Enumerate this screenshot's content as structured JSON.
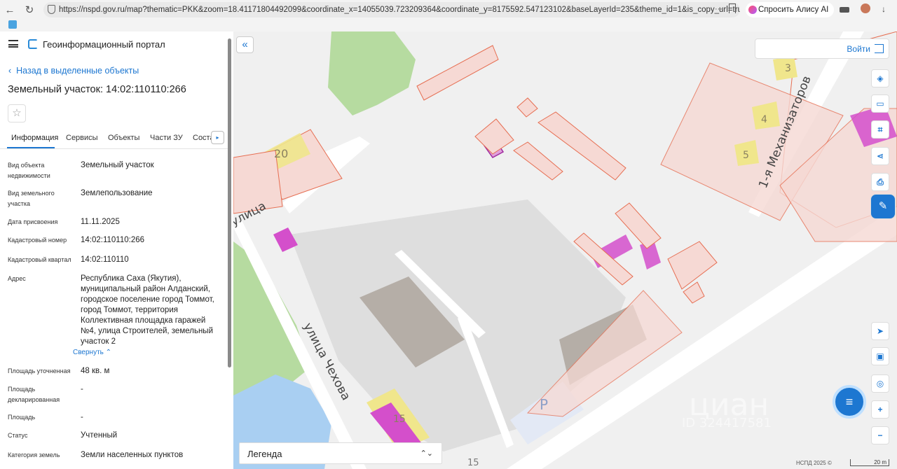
{
  "browser": {
    "url": "https://nspd.gov.ru/map?thematic=PKK&zoom=18.41171804492099&coordinate_x=14055039.723209364&coordinate_y=8175592.547123102&baseLayerId=235&theme_id=1&is_copy_url=true&a...",
    "assistant_label": "Спросить Алису AI",
    "menu_dots": "···"
  },
  "panel": {
    "portal_name": "Геоинформационный портал",
    "back_link": "Назад в выделенные объекты",
    "title": "Земельный участок: 14:02:110110:266",
    "star": "☆",
    "tabs": [
      "Информация",
      "Сервисы",
      "Объекты",
      "Части ЗУ",
      "Соста"
    ],
    "tab_next": "▸",
    "collapse_link": "Свернуть",
    "fields": [
      {
        "label": "Вид объекта недвижимости",
        "value": "Земельный участок"
      },
      {
        "label": "Вид земельного участка",
        "value": "Землепользование"
      },
      {
        "label": "Дата присвоения",
        "value": "11.11.2025"
      },
      {
        "label": "Кадастровый номер",
        "value": "14:02:110110:266"
      },
      {
        "label": "Кадастровый квартал",
        "value": "14:02:110110"
      },
      {
        "label": "Адрес",
        "value": "Республика Саха (Якутия), муниципальный район Алданский, городское поселение город Томмот, город Томмот, территория Коллективная площадка гаражей №4, улица Строителей, земельный участок 2"
      },
      {
        "label": "Площадь уточненная",
        "value": "48 кв. м"
      },
      {
        "label": "Площадь декларированная",
        "value": "-"
      },
      {
        "label": "Площадь",
        "value": "-"
      },
      {
        "label": "Статус",
        "value": "Учтенный"
      },
      {
        "label": "Категория земель",
        "value": "Земли населенных пунктов"
      }
    ]
  },
  "map": {
    "collapse_button": "«",
    "login_label": "Войти",
    "street_labels": [
      "улица Чехова",
      "1-я Механизаторов",
      "улица"
    ],
    "building_numbers": [
      "20",
      "3",
      "4",
      "5",
      "15",
      "15"
    ],
    "parking_label": "P",
    "watermark": "циан",
    "watermark_id": "ID 324417581",
    "legend_label": "Легенда",
    "legend_toggle": "⌃⌄",
    "copyright": "НСПД 2025 ©",
    "scale": "20 m",
    "zoom_in": "+",
    "zoom_out": "−",
    "colors": {
      "parcel": "#f6d9d4",
      "parcel_stroke": "#e66e52",
      "highlight": "#d44fcb",
      "building": "#f0e68c",
      "water": "#a9cff2",
      "green": "#b6dba0",
      "road": "#ffffff"
    }
  }
}
